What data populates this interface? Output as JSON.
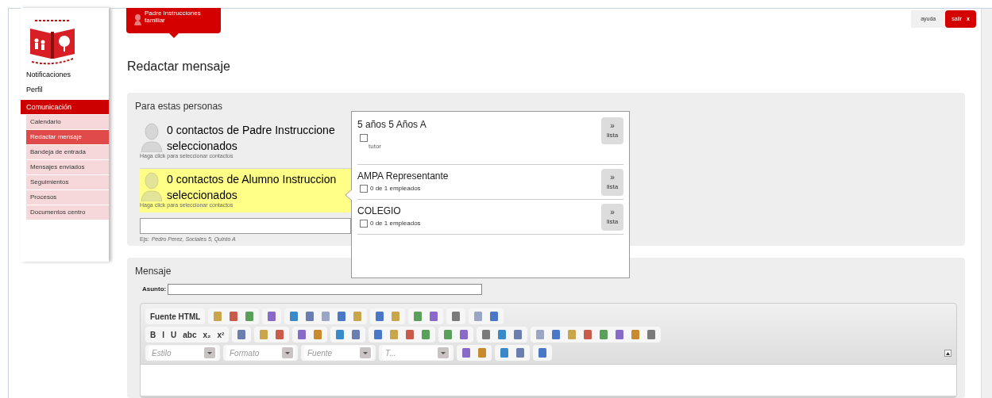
{
  "user_tab": {
    "name": "Padre Instrucciones",
    "role": "familiar"
  },
  "top_buttons": [
    {
      "label": "ayuda",
      "kind": "plain"
    },
    {
      "label": "salir",
      "icon": "x",
      "kind": "danger"
    }
  ],
  "sidebar": {
    "items": [
      {
        "label": "Notificaciones",
        "selected": false
      },
      {
        "label": "Perfil",
        "selected": false
      },
      {
        "label": "Comunicación",
        "selected": true,
        "children": [
          {
            "label": "Calendario",
            "selected": false
          },
          {
            "label": "Redactar mensaje",
            "selected": true
          },
          {
            "label": "Bandeja de entrada",
            "selected": false
          },
          {
            "label": "Mensajes enviados",
            "selected": false
          },
          {
            "label": "Seguimientos",
            "selected": false
          },
          {
            "label": "Procesos",
            "selected": false
          },
          {
            "label": "Documentos centro",
            "selected": false
          }
        ]
      }
    ]
  },
  "page_title": "Redactar mensaje",
  "recipients": {
    "title": "Para estas personas",
    "groups": [
      {
        "lines": [
          "0 contactos de Padre Instruccione",
          "seleccionados"
        ],
        "hint": "Haga click para seleccionar contactos",
        "selected": false
      },
      {
        "lines": [
          "0 contactos de Alumno Instruccion",
          "seleccionados"
        ],
        "hint": "Haga click para seleccionar contactos",
        "selected": true
      }
    ],
    "example": {
      "prefix": "Ejs:",
      "text": "Pedro Perez, Sociales 5, Quinto A"
    }
  },
  "popup": {
    "groups": [
      {
        "title": "5 años 5 Años A",
        "checked": false,
        "sublabel": "tutor",
        "kind": "below",
        "button": {
          "icon": "»",
          "label": "lista"
        }
      },
      {
        "title": "AMPA Representante",
        "checked": false,
        "sublabel": "0 de 1 empleados",
        "kind": "inline",
        "button": {
          "icon": "»",
          "label": "lista"
        }
      },
      {
        "title": "COLEGIO",
        "checked": false,
        "sublabel": "0 de 1 empleados",
        "kind": "inline",
        "button": {
          "icon": "»",
          "label": "lista"
        }
      }
    ]
  },
  "message": {
    "title": "Mensaje",
    "subject_label": "Asunto:",
    "toolbar": [
      [
        [
          {
            "kind": "text",
            "label": "Fuente HTML"
          }
        ],
        [
          {
            "kind": "icon"
          },
          {
            "kind": "icon"
          },
          {
            "kind": "icon"
          }
        ],
        [
          {
            "kind": "icon"
          }
        ],
        [
          {
            "kind": "icon"
          },
          {
            "kind": "icon"
          },
          {
            "kind": "icon"
          },
          {
            "kind": "icon"
          },
          {
            "kind": "icon"
          }
        ],
        [
          {
            "kind": "icon"
          },
          {
            "kind": "icon"
          }
        ],
        [
          {
            "kind": "icon"
          },
          {
            "kind": "icon"
          }
        ],
        [
          {
            "kind": "icon"
          }
        ],
        [
          {
            "kind": "icon"
          },
          {
            "kind": "icon"
          }
        ]
      ],
      [
        [
          {
            "kind": "text",
            "label": "B"
          },
          {
            "kind": "text",
            "label": "I"
          },
          {
            "kind": "text",
            "label": "U"
          },
          {
            "kind": "text",
            "label": "abc"
          },
          {
            "kind": "text",
            "label": "x₂"
          },
          {
            "kind": "text",
            "label": "x²"
          }
        ],
        [
          {
            "kind": "icon"
          }
        ],
        [
          {
            "kind": "icon"
          },
          {
            "kind": "icon"
          }
        ],
        [
          {
            "kind": "icon"
          },
          {
            "kind": "icon"
          }
        ],
        [
          {
            "kind": "icon"
          },
          {
            "kind": "icon"
          }
        ],
        [
          {
            "kind": "icon"
          },
          {
            "kind": "icon"
          },
          {
            "kind": "icon"
          },
          {
            "kind": "icon"
          }
        ],
        [
          {
            "kind": "icon"
          },
          {
            "kind": "icon"
          }
        ],
        [
          {
            "kind": "icon"
          },
          {
            "kind": "icon"
          },
          {
            "kind": "icon"
          }
        ],
        [
          {
            "kind": "icon"
          },
          {
            "kind": "icon"
          },
          {
            "kind": "icon"
          },
          {
            "kind": "icon"
          },
          {
            "kind": "icon"
          },
          {
            "kind": "icon"
          },
          {
            "kind": "icon"
          },
          {
            "kind": "icon"
          }
        ]
      ],
      [
        [
          {
            "kind": "select",
            "label": "Estilo"
          }
        ],
        [
          {
            "kind": "select",
            "label": "Formato"
          }
        ],
        [
          {
            "kind": "select",
            "label": "Fuente"
          }
        ],
        [
          {
            "kind": "select",
            "label": "T..."
          }
        ],
        [
          {
            "kind": "icon"
          },
          {
            "kind": "icon"
          }
        ],
        [
          {
            "kind": "icon"
          },
          {
            "kind": "icon"
          }
        ],
        [
          {
            "kind": "icon"
          }
        ]
      ]
    ]
  }
}
